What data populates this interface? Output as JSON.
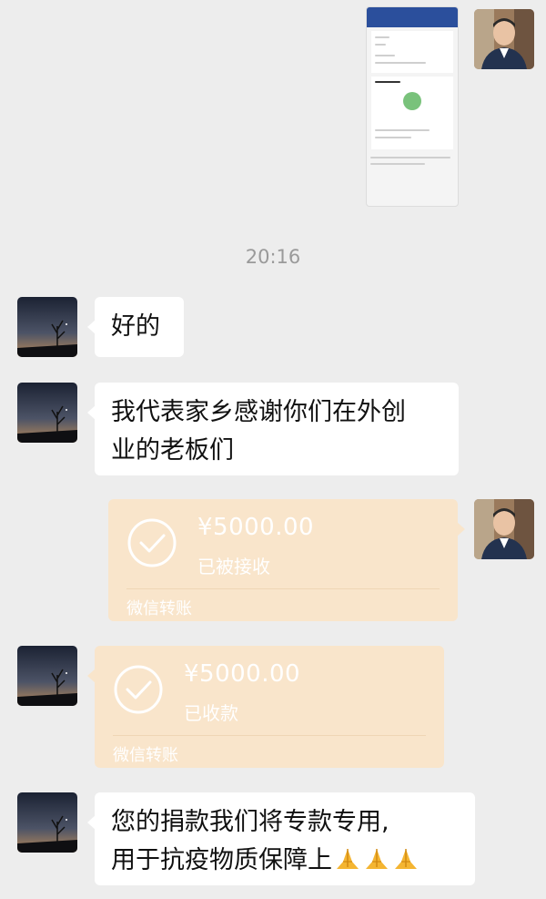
{
  "time_divider": "20:16",
  "image_message": {
    "kind": "screenshot-image",
    "header_color": "#2b4f9c"
  },
  "messages": [
    {
      "side": "left",
      "type": "text",
      "text": "好的"
    },
    {
      "side": "left",
      "type": "text",
      "lines": [
        "我代表家乡感谢你们在外创",
        "业的老板们"
      ]
    },
    {
      "side": "right",
      "type": "transfer",
      "amount": "¥5000.00",
      "status": "已被接收",
      "label": "微信转账"
    },
    {
      "side": "left",
      "type": "transfer",
      "amount": "¥5000.00",
      "status": "已收款",
      "label": "微信转账"
    },
    {
      "side": "left",
      "type": "text",
      "lines": [
        "您的捐款我们将专款专用,",
        "用于抗疫物质保障上"
      ],
      "emoji": [
        "praise-icon",
        "praise-icon",
        "praise-icon"
      ]
    }
  ],
  "colors": {
    "background": "#ededed",
    "bubble": "#ffffff",
    "transfer": "#f9e5cb",
    "time": "#9a9a9a"
  }
}
